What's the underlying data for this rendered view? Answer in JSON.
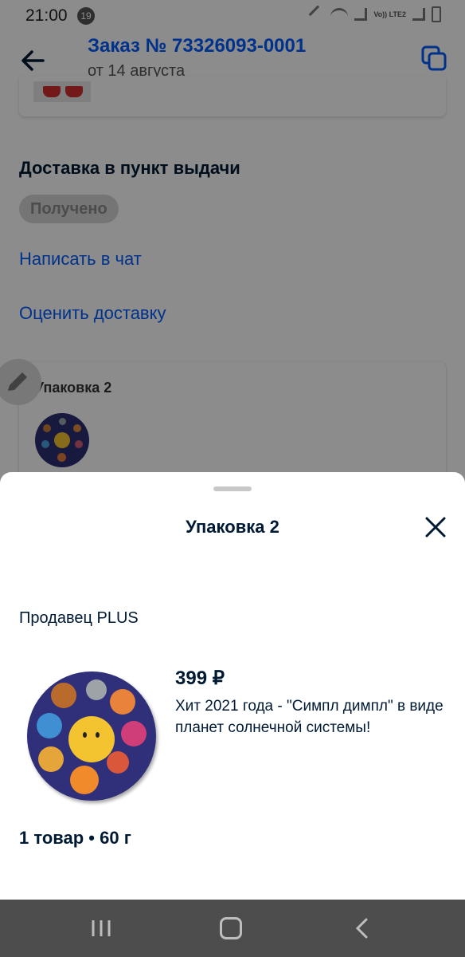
{
  "status_bar": {
    "time": "21:00",
    "notification_count": "19",
    "network_label": "Vo)) LTE2"
  },
  "header": {
    "title": "Заказ № 73326093-0001",
    "subtitle": "от 14 августа"
  },
  "delivery": {
    "title": "Доставка в пункт выдачи",
    "status": "Получено",
    "chat_link": "Написать в чат",
    "rate_link": "Оценить доставку"
  },
  "package_card": {
    "label": "Упаковка 2"
  },
  "sheet": {
    "title": "Упаковка 2",
    "seller": "Продавец PLUS",
    "product": {
      "price": "399 ₽",
      "description": "Хит 2021 года - \"Симпл димпл\" в виде планет солнечной системы!"
    },
    "summary": "1 товар • 60 г"
  },
  "colors": {
    "accent": "#005bff",
    "text": "#001a34",
    "nav_bar": "#4d4d4d"
  }
}
